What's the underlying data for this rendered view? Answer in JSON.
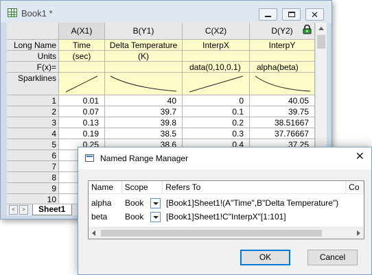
{
  "workbook": {
    "title": "Book1 *",
    "columns": [
      {
        "header": "A(X1)",
        "long_name": "Time",
        "units": "(sec)",
        "formula": ""
      },
      {
        "header": "B(Y1)",
        "long_name": "Delta Temperature",
        "units": "(K)",
        "formula": ""
      },
      {
        "header": "C(X2)",
        "long_name": "InterpX",
        "units": "",
        "formula": "data(0,10,0.1)"
      },
      {
        "header": "D(Y2)",
        "long_name": "InterpY",
        "units": "",
        "formula": "alpha(beta)"
      }
    ],
    "row_labels": {
      "long_name": "Long Name",
      "units": "Units",
      "formula": "F(x)=",
      "sparklines": "Sparklines"
    },
    "rows": [
      {
        "n": "1",
        "a": "0.01",
        "b": "40",
        "c": "0",
        "d": "40.05"
      },
      {
        "n": "2",
        "a": "0.07",
        "b": "39.7",
        "c": "0.1",
        "d": "39.75"
      },
      {
        "n": "3",
        "a": "0.13",
        "b": "39.8",
        "c": "0.2",
        "d": "38.51667"
      },
      {
        "n": "4",
        "a": "0.19",
        "b": "38.5",
        "c": "0.3",
        "d": "37.76667"
      },
      {
        "n": "5",
        "a": "0.25",
        "b": "38.6",
        "c": "0.4",
        "d": "37.25"
      },
      {
        "n": "6",
        "a": "",
        "b": "",
        "c": "",
        "d": ""
      },
      {
        "n": "7",
        "a": "",
        "b": "",
        "c": "",
        "d": ""
      },
      {
        "n": "8",
        "a": "",
        "b": "",
        "c": "",
        "d": ""
      },
      {
        "n": "9",
        "a": "",
        "b": "",
        "c": "",
        "d": ""
      },
      {
        "n": "10",
        "a": "",
        "b": "",
        "c": "",
        "d": ""
      }
    ],
    "sheet_tab": "Sheet1",
    "tab_nav": {
      "prev": "<",
      "next": ">"
    }
  },
  "dialog": {
    "title": "Named Range Manager",
    "columns": {
      "name": "Name",
      "scope": "Scope",
      "refers_to": "Refers To",
      "comment": "Co"
    },
    "items": [
      {
        "name": "alpha",
        "scope": "Book",
        "refers_to": "[Book1]Sheet1!(A\"Time\",B\"Delta Temperature\")"
      },
      {
        "name": "beta",
        "scope": "Book",
        "refers_to": "[Book1]Sheet1!C\"InterpX\"[1:101]"
      }
    ],
    "ok_label": "OK",
    "cancel_label": "Cancel"
  }
}
